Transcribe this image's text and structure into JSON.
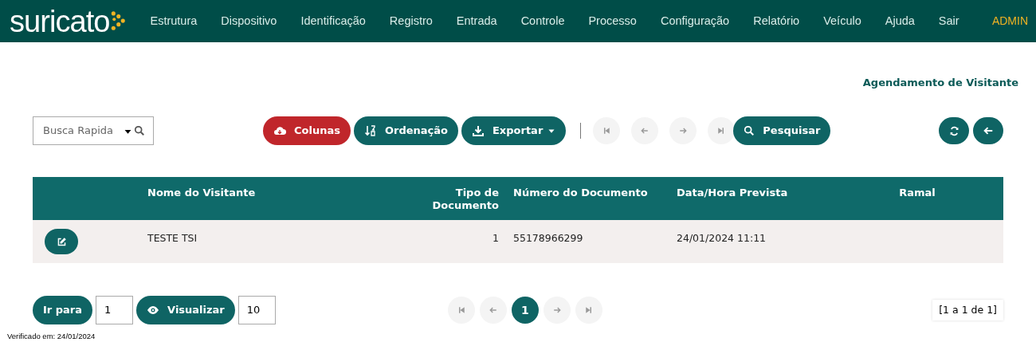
{
  "nav": {
    "logo": "suricato",
    "items": [
      "Estrutura",
      "Dispositivo",
      "Identificação",
      "Registro",
      "Entrada",
      "Controle",
      "Processo",
      "Configuração",
      "Relatório",
      "Veículo",
      "Ajuda",
      "Sair"
    ],
    "user": "ADMIN"
  },
  "page_title": "Agendamento de Visitante",
  "toolbar": {
    "search": {
      "placeholder": "Busca Rapida"
    },
    "buttons": [
      {
        "kind": "columns",
        "label": "Colunas"
      },
      {
        "kind": "sort",
        "label": "Ordenação"
      },
      {
        "kind": "export",
        "label": "Exportar"
      }
    ],
    "pager": [
      {
        "kind": "first",
        "disabled": true
      },
      {
        "kind": "prev",
        "disabled": true
      },
      {
        "kind": "next",
        "disabled": true
      },
      {
        "kind": "last",
        "disabled": true
      }
    ],
    "search_button": "Pesquisar"
  },
  "table": {
    "columns": [
      "Nome do Visitante",
      "Tipo de Documento",
      "Número do Documento",
      "Data/Hora Prevista",
      "Ramal"
    ],
    "rows": [
      {
        "cells": [
          "TESTE TSI",
          "1",
          "55178966299",
          "24/01/2024 11:11",
          ""
        ]
      }
    ]
  },
  "footer": {
    "goto_label": "Ir para",
    "goto_value": "1",
    "view_label": "Visualizar",
    "view_value": "10",
    "pager": [
      {
        "kind": "first",
        "disabled": true
      },
      {
        "kind": "prev",
        "disabled": true
      },
      {
        "kind": "page",
        "label": "1",
        "selected": true
      },
      {
        "kind": "next",
        "disabled": true
      },
      {
        "kind": "last",
        "disabled": true
      }
    ],
    "range": "[1 a 1 de 1]",
    "verified": "Verificado em: 24/01/2024"
  }
}
